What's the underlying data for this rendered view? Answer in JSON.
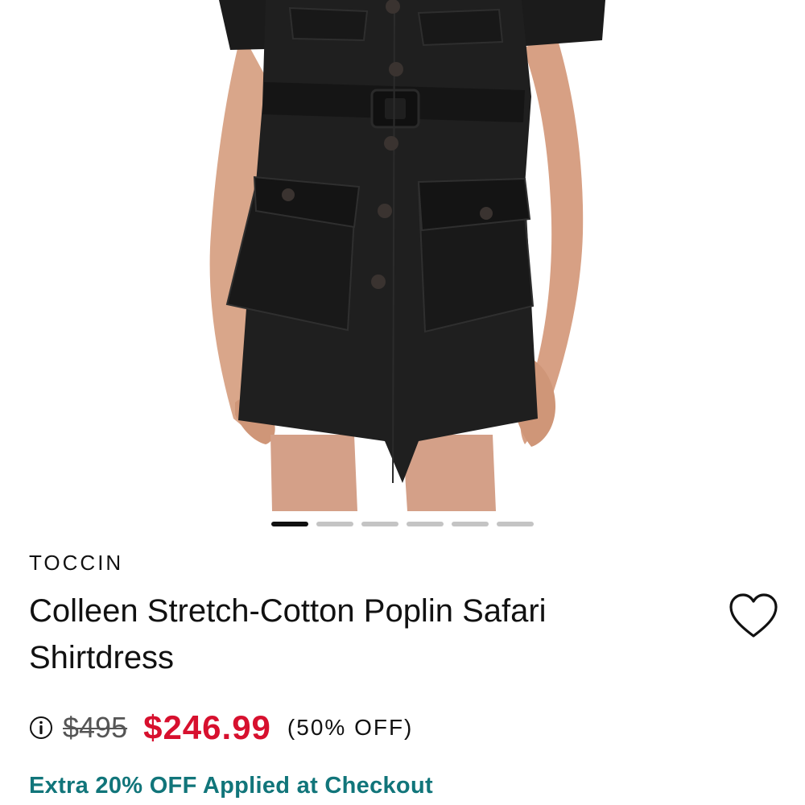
{
  "product": {
    "brand": "TOCCIN",
    "title": "Colleen Stretch-Cotton Poplin Safari Shirtdress",
    "original_price": "$495",
    "sale_price": "$246.99",
    "discount": "(50% OFF)",
    "promo": "Extra 20% OFF Applied at Checkout"
  },
  "carousel": {
    "slide_count": 6,
    "active_index": 0
  },
  "colors": {
    "sale_price": "#d7102e",
    "promo": "#11757a",
    "dot_active": "#111111",
    "dot_inactive": "#c4c4c4"
  },
  "icons": {
    "wishlist": "heart-icon",
    "price_info": "info-icon"
  }
}
